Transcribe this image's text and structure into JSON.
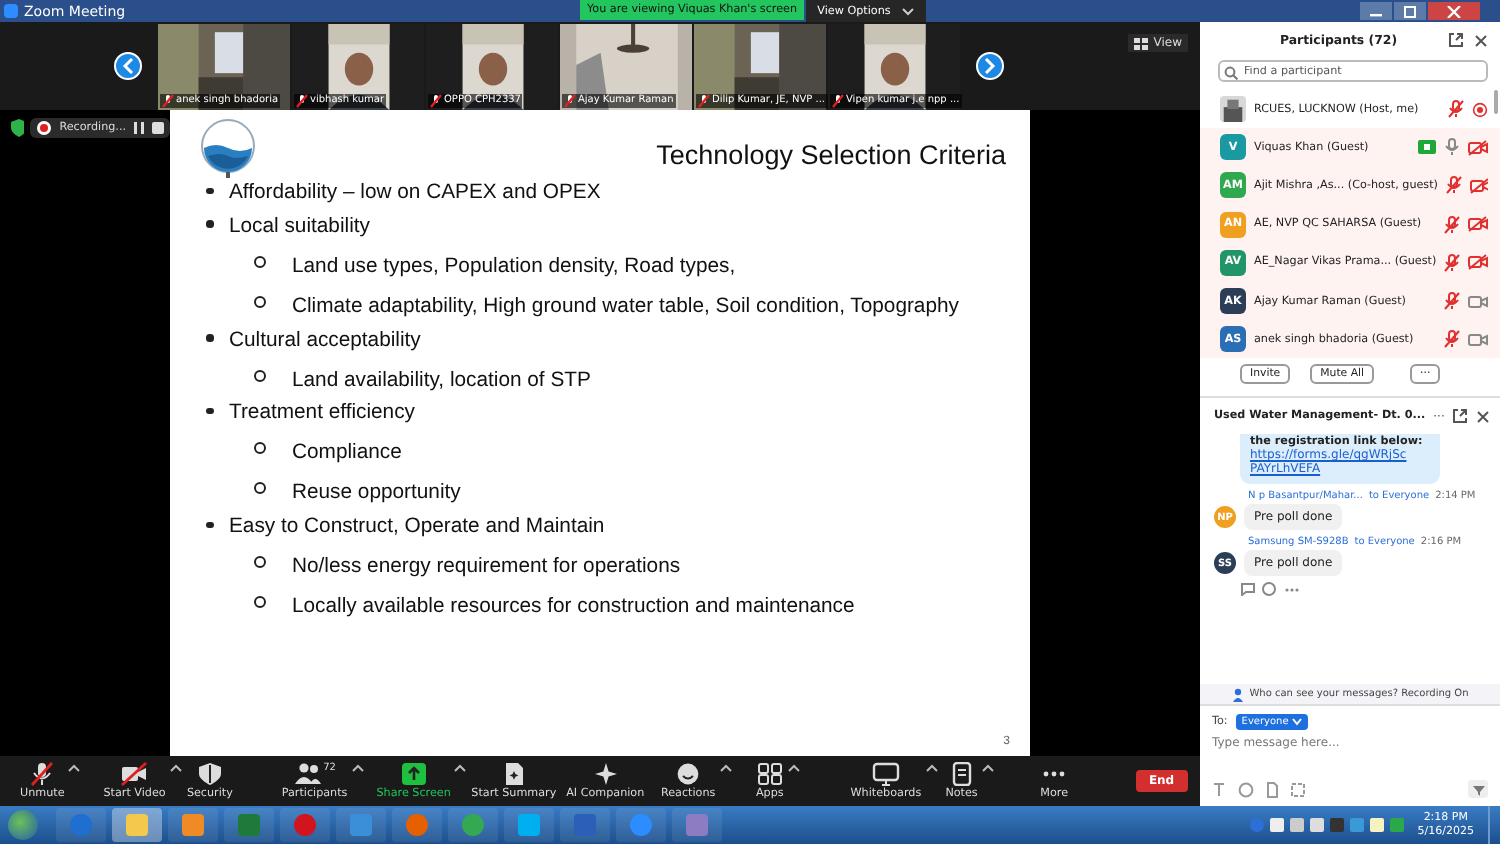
{
  "window": {
    "title": "Zoom Meeting"
  },
  "share_banner": "You are viewing Viquas Khan's screen",
  "view_options": "View Options",
  "videos": [
    {
      "name": "anek singh bhadoria",
      "kind": "room"
    },
    {
      "name": "vibhash kumar",
      "kind": "person"
    },
    {
      "name": "OPPO CPH2337",
      "kind": "person"
    },
    {
      "name": "Ajay Kumar Raman",
      "kind": "ceiling"
    },
    {
      "name": "Dilip Kumar, JE, NVP ...",
      "kind": "room"
    },
    {
      "name": "Vipen kumar j.e  npp ...",
      "kind": "person"
    }
  ],
  "view_button": "View",
  "recording": {
    "label": "Recording..."
  },
  "slide": {
    "title": "Technology Selection Criteria",
    "page": "3",
    "bullets": [
      {
        "text": "Affordability – low on CAPEX and OPEX"
      },
      {
        "text": "Local suitability",
        "children": [
          "Land use types, Population density, Road types,",
          "Climate adaptability, High ground water table, Soil condition, Topography"
        ]
      },
      {
        "text": "Cultural acceptability",
        "children": [
          "Land availability, location of STP"
        ]
      },
      {
        "text": "Treatment efficiency",
        "children": [
          "Compliance",
          "Reuse opportunity"
        ]
      },
      {
        "text": "Easy to Construct, Operate and Maintain",
        "children": [
          "No/less energy requirement for operations",
          "Locally available resources for construction and maintenance"
        ]
      }
    ]
  },
  "toolbar": [
    {
      "label": "Unmute",
      "kind": "mic",
      "caret": true,
      "highlighted": false
    },
    {
      "label": "Start Video",
      "kind": "video",
      "caret": true,
      "highlighted": false
    },
    {
      "label": "Security",
      "kind": "shield",
      "caret": false,
      "highlighted": false
    },
    {
      "label": "Participants",
      "kind": "people",
      "badge": "72",
      "caret": true,
      "highlighted": false
    },
    {
      "label": "Share Screen",
      "kind": "share",
      "caret": true,
      "highlighted": true
    },
    {
      "label": "Start Summary",
      "kind": "doc",
      "caret": false,
      "highlighted": false
    },
    {
      "label": "AI Companion",
      "kind": "sparkle",
      "caret": false,
      "highlighted": false
    },
    {
      "label": "Reactions",
      "kind": "smile",
      "caret": true,
      "highlighted": false
    },
    {
      "label": "Apps",
      "kind": "apps",
      "caret": true,
      "highlighted": false
    },
    {
      "label": "Whiteboards",
      "kind": "board",
      "caret": true,
      "highlighted": false
    },
    {
      "label": "Notes",
      "kind": "note",
      "caret": true,
      "highlighted": false
    },
    {
      "label": "More",
      "kind": "more",
      "caret": false,
      "highlighted": false
    }
  ],
  "end_button": "End",
  "participants": {
    "title": "Participants (72)",
    "search_placeholder": "Find a participant",
    "items": [
      {
        "kind": "picture",
        "name": "RCUES, LUCKNOW (Host, me)",
        "muted": true,
        "recording": true,
        "sharing": false
      },
      {
        "initials": "V",
        "kind": "initials",
        "name": "Viquas Khan (Guest)",
        "muted": false,
        "camera_off": true,
        "recording": false,
        "sharing": true,
        "color": "#1a9aa0"
      },
      {
        "initials": "AM",
        "kind": "initials",
        "name": "Ajit Mishra ,As...  (Co-host, guest)",
        "muted": true,
        "camera_off": true,
        "recording": false,
        "sharing": false,
        "color": "#2fa84f"
      },
      {
        "initials": "AN",
        "kind": "initials",
        "name": "AE, NVP QC SAHARSA (Guest)",
        "muted": true,
        "camera_off": true,
        "recording": false,
        "sharing": false,
        "color": "#f0a020"
      },
      {
        "initials": "AV",
        "kind": "initials",
        "name": "AE_Nagar Vikas Prama...  (Guest)",
        "muted": true,
        "camera_off": true,
        "recording": false,
        "sharing": false,
        "color": "#22946a"
      },
      {
        "initials": "AK",
        "kind": "initials",
        "name": "Ajay Kumar Raman (Guest)",
        "muted": true,
        "camera_off": false,
        "recording": false,
        "sharing": false,
        "color": "#2c3e57"
      },
      {
        "initials": "AS",
        "kind": "initials",
        "name": "anek singh bhadoria (Guest)",
        "muted": true,
        "camera_off": false,
        "recording": false,
        "sharing": false,
        "color": "#2a6fb5"
      }
    ],
    "buttons": [
      "Invite",
      "Mute All"
    ],
    "more": "···"
  },
  "chat": {
    "title": "Used Water Management-  Dt. 0...",
    "more": "···",
    "top_message": {
      "text": "the registration link below:",
      "link": "https://forms.gle/qgWRjScPAYrLhVEFA"
    },
    "messages": [
      {
        "initials": "NP",
        "color": "#f0a020",
        "sender": "N p Basantpur/Mahar...",
        "to": "to Everyone",
        "time": "2:14 PM",
        "text": "Pre poll done"
      },
      {
        "initials": "SS",
        "color": "#2c3e57",
        "sender": "Samsung SM-S928B",
        "to": "to Everyone",
        "time": "2:16 PM",
        "text": "Pre poll done"
      }
    ],
    "privacy": "Who can see your messages? Recording On",
    "to_label": "To:",
    "recipient": "Everyone",
    "input_placeholder": "Type message here..."
  },
  "taskbar": {
    "time": "2:18 PM",
    "date": "5/16/2025"
  }
}
